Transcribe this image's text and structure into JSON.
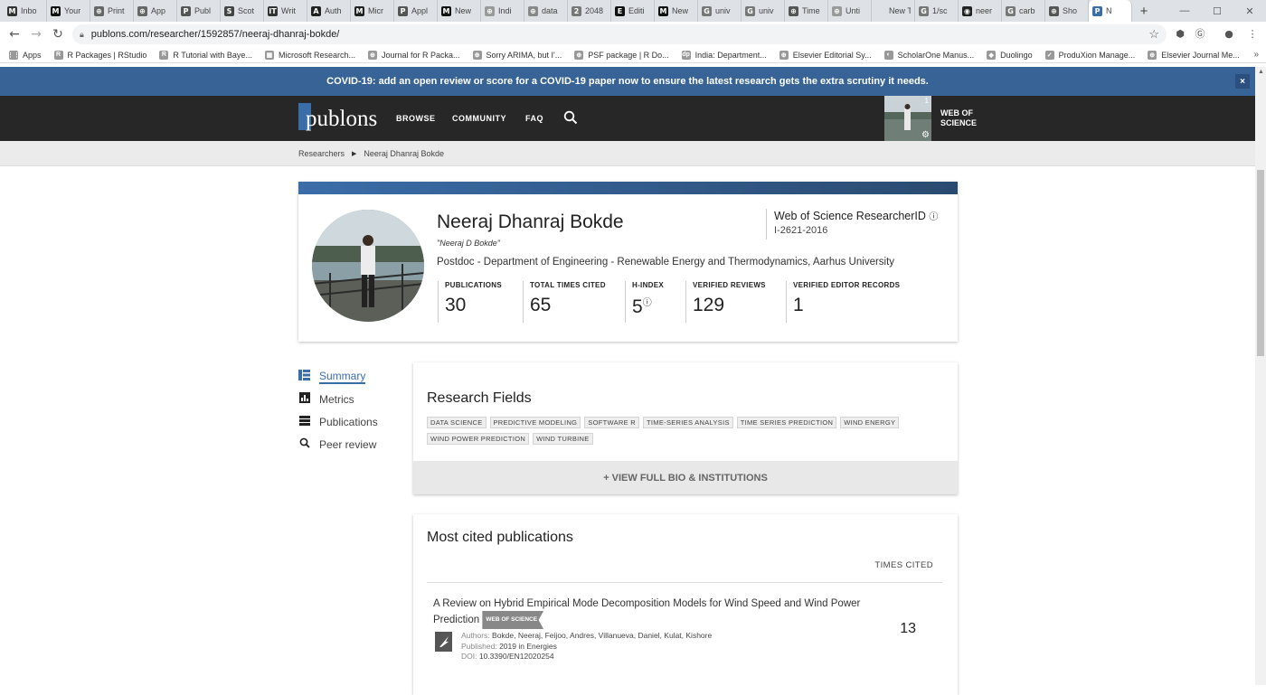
{
  "browser": {
    "tabs": [
      {
        "label": "Inbo",
        "icon": "M",
        "color": "#333333"
      },
      {
        "label": "Your",
        "icon": "M",
        "color": "#111111"
      },
      {
        "label": "Print",
        "icon": "⊕",
        "color": "#666666"
      },
      {
        "label": "App",
        "icon": "⊕",
        "color": "#666666"
      },
      {
        "label": "Publ",
        "icon": "P",
        "color": "#555555"
      },
      {
        "label": "Scot",
        "icon": "S",
        "color": "#444444"
      },
      {
        "label": "Writ",
        "icon": "IT",
        "color": "#333333"
      },
      {
        "label": "Auth",
        "icon": "A",
        "color": "#222222"
      },
      {
        "label": "Micr",
        "icon": "M",
        "color": "#222222"
      },
      {
        "label": "Appl",
        "icon": "P",
        "color": "#555555"
      },
      {
        "label": "New",
        "icon": "M",
        "color": "#111111"
      },
      {
        "label": "Indi",
        "icon": "⊕",
        "color": "#999999"
      },
      {
        "label": "data",
        "icon": "⊕",
        "color": "#888888"
      },
      {
        "label": "2048",
        "icon": "2",
        "color": "#777777"
      },
      {
        "label": "Editi",
        "icon": "E",
        "color": "#111111"
      },
      {
        "label": "New",
        "icon": "M",
        "color": "#111111"
      },
      {
        "label": "univ",
        "icon": "G",
        "color": "#777777"
      },
      {
        "label": "univ",
        "icon": "G",
        "color": "#777777"
      },
      {
        "label": "Time",
        "icon": "⊕",
        "color": "#555555"
      },
      {
        "label": "Unti",
        "icon": "⊕",
        "color": "#999999"
      },
      {
        "label": "New Tab",
        "icon": "",
        "color": "#dee1e6"
      },
      {
        "label": "1/sc",
        "icon": "G",
        "color": "#777777"
      },
      {
        "label": "neer",
        "icon": "◉",
        "color": "#222222"
      },
      {
        "label": "carb",
        "icon": "G",
        "color": "#777777"
      },
      {
        "label": "Sho",
        "icon": "⊕",
        "color": "#555555"
      },
      {
        "label": "N",
        "icon": "P",
        "color": "#3b6da8",
        "active": true
      }
    ],
    "new_tab": "+",
    "url": "publons.com/researcher/1592857/neeraj-dhanraj-bokde/",
    "bookmarks": [
      {
        "label": "Apps",
        "icon": "⋮⋮"
      },
      {
        "label": "R Packages | RStudio",
        "icon": "R"
      },
      {
        "label": "R Tutorial with Baye...",
        "icon": "R"
      },
      {
        "label": "Microsoft Research...",
        "icon": "▦"
      },
      {
        "label": "Journal for R Packa...",
        "icon": "⊕"
      },
      {
        "label": "Sorry ARIMA, but I'...",
        "icon": "⊕"
      },
      {
        "label": "PSF package | R Do...",
        "icon": "⊕"
      },
      {
        "label": "India: Department...",
        "icon": "dp"
      },
      {
        "label": "Elsevier Editorial Sy...",
        "icon": "⊕"
      },
      {
        "label": "ScholarOne Manus...",
        "icon": "◐"
      },
      {
        "label": "Duolingo",
        "icon": "◆"
      },
      {
        "label": "ProduXion Manage...",
        "icon": "✓"
      },
      {
        "label": "Elsevier Journal Me...",
        "icon": "⊕"
      }
    ],
    "bookmarks_more": "»"
  },
  "banner": {
    "text": "COVID-19: add an open review or score for a COVID-19 paper now to ensure the latest research gets the extra scrutiny it needs.",
    "close": "×"
  },
  "nav": {
    "logo": "publons",
    "links": [
      "BROWSE",
      "COMMUNITY",
      "FAQ"
    ],
    "notification_count": "1",
    "wos_line1": "WEB OF",
    "wos_line2": "SCIENCE"
  },
  "breadcrumb": {
    "root": "Researchers",
    "current": "Neeraj Dhanraj Bokde"
  },
  "profile": {
    "name": "Neeraj Dhanraj Bokde",
    "alias": "\"Neeraj D Bokde\"",
    "affiliation": "Postdoc - Department of Engineering - Renewable Energy and Thermodynamics, Aarhus University",
    "researcher_id_label": "Web of Science ResearcherID",
    "researcher_id": "I-2621-2016",
    "stats": [
      {
        "label": "PUBLICATIONS",
        "value": "30"
      },
      {
        "label": "TOTAL TIMES CITED",
        "value": "65"
      },
      {
        "label": "H-INDEX",
        "value": "5"
      },
      {
        "label": "VERIFIED REVIEWS",
        "value": "129"
      },
      {
        "label": "VERIFIED EDITOR RECORDS",
        "value": "1"
      }
    ]
  },
  "sidebar": [
    {
      "label": "Summary",
      "icon": "summary-icon",
      "glyph": "▮▤",
      "active": true
    },
    {
      "label": "Metrics",
      "icon": "metrics-icon",
      "glyph": "▟"
    },
    {
      "label": "Publications",
      "icon": "publications-icon",
      "glyph": "☰"
    },
    {
      "label": "Peer review",
      "icon": "search-icon",
      "glyph": "⚲"
    }
  ],
  "research_fields": {
    "title": "Research Fields",
    "tags": [
      "DATA SCIENCE",
      "PREDICTIVE MODELING",
      "SOFTWARE R",
      "TIME-SERIES ANALYSIS",
      "TIME SERIES PREDICTION",
      "WIND ENERGY",
      "WIND POWER PREDICTION",
      "WIND TURBINE"
    ],
    "bio_button": "+ VIEW FULL BIO & INSTITUTIONS"
  },
  "most_cited": {
    "title": "Most cited publications",
    "column": "TIMES CITED",
    "items": [
      {
        "title": "A Review on Hybrid Empirical Mode Decomposition Models for Wind Speed and Wind Power Prediction",
        "badge": "WEB OF SCIENCE",
        "authors_label": "Authors:",
        "authors": "Bokde, Neeraj, Feijoo, Andres, Villanueva, Daniel, Kulat, Kishore",
        "published_label": "Published:",
        "published": "2019 in Energies",
        "doi_label": "DOI:",
        "doi": "10.3390/EN12020254",
        "times_cited": "13"
      }
    ]
  }
}
